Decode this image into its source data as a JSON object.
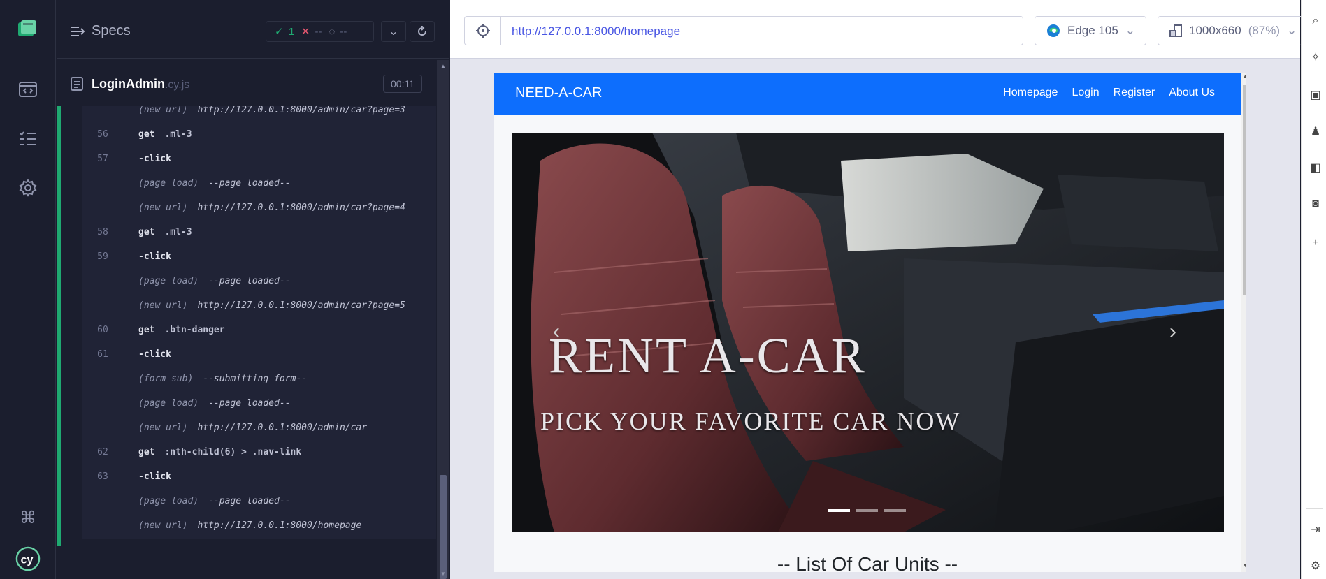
{
  "specs_header": {
    "title": "Specs",
    "passed": "1",
    "failed": "--",
    "pending": "--"
  },
  "spec": {
    "name": "LoginAdmin",
    "ext": ".cy.js",
    "timer": "00:11"
  },
  "commands": [
    {
      "num": "",
      "name": "(new url)",
      "message": "http://127.0.0.1:8000/admin/car?page=3",
      "event": true
    },
    {
      "num": "56",
      "name": "get",
      "message": ".ml-3",
      "event": false
    },
    {
      "num": "57",
      "name": "-click",
      "message": "",
      "event": false
    },
    {
      "num": "",
      "name": "(page load)",
      "message": "--page loaded--",
      "event": true
    },
    {
      "num": "",
      "name": "(new url)",
      "message": "http://127.0.0.1:8000/admin/car?page=4",
      "event": true
    },
    {
      "num": "58",
      "name": "get",
      "message": ".ml-3",
      "event": false
    },
    {
      "num": "59",
      "name": "-click",
      "message": "",
      "event": false
    },
    {
      "num": "",
      "name": "(page load)",
      "message": "--page loaded--",
      "event": true
    },
    {
      "num": "",
      "name": "(new url)",
      "message": "http://127.0.0.1:8000/admin/car?page=5",
      "event": true
    },
    {
      "num": "60",
      "name": "get",
      "message": ".btn-danger",
      "event": false
    },
    {
      "num": "61",
      "name": "-click",
      "message": "",
      "event": false
    },
    {
      "num": "",
      "name": "(form sub)",
      "message": "--submitting form--",
      "event": true
    },
    {
      "num": "",
      "name": "(page load)",
      "message": "--page loaded--",
      "event": true
    },
    {
      "num": "",
      "name": "(new url)",
      "message": "http://127.0.0.1:8000/admin/car",
      "event": true
    },
    {
      "num": "62",
      "name": "get",
      "message": ":nth-child(6) > .nav-link",
      "event": false
    },
    {
      "num": "63",
      "name": "-click",
      "message": "",
      "event": false
    },
    {
      "num": "",
      "name": "(page load)",
      "message": "--page loaded--",
      "event": true
    },
    {
      "num": "",
      "name": "(new url)",
      "message": "http://127.0.0.1:8000/homepage",
      "event": true
    }
  ],
  "aut": {
    "url": "http://127.0.0.1:8000/homepage",
    "browser": "Edge 105",
    "viewport": "1000x660",
    "scale": "(87%)"
  },
  "site": {
    "brand": "NEED-A-CAR",
    "nav": [
      "Homepage",
      "Login",
      "Register",
      "About Us"
    ],
    "carousel": {
      "caption_title": "RENT A-CAR",
      "caption_sub": "PICK YOUR FAVORITE CAR NOW",
      "active_slide": 1,
      "slides": 3
    },
    "list_title": "-- List Of Car Units --"
  },
  "colors": {
    "navbar": "#0d6efd",
    "pass": "#1fa971",
    "fail": "#e45770",
    "url": "#4956e3"
  }
}
